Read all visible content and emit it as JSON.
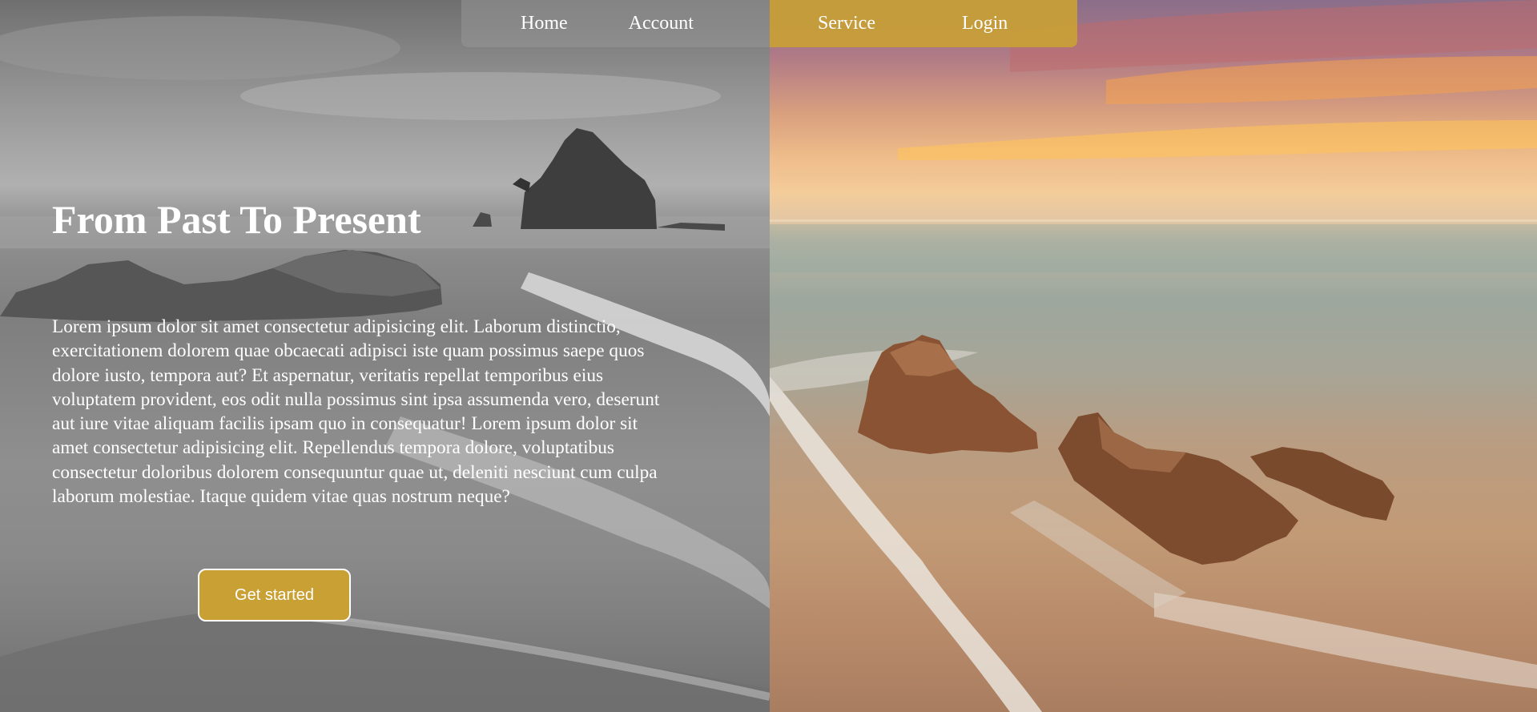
{
  "nav": {
    "items": [
      {
        "label": "Home"
      },
      {
        "label": "Account"
      },
      {
        "label": "Service"
      },
      {
        "label": "Login"
      }
    ]
  },
  "hero": {
    "title": "From Past To Present",
    "body": "Lorem ipsum dolor sit amet consectetur adipisicing elit. Laborum distinctio, exercitationem dolorem quae obcaecati adipisci iste quam possimus saepe quos dolore iusto, tempora aut? Et aspernatur, veritatis repellat temporibus eius voluptatem provident, eos odit nulla possimus sint ipsa assumenda vero, deserunt aut iure vitae aliquam facilis ipsam quo in consequatur! Lorem ipsum dolor sit amet consectetur adipisicing elit. Repellendus tempora dolore, voluptatibus consectetur doloribus dolorem consequuntur quae ut, deleniti nesciunt cum culpa laborum molestiae. Itaque quidem vitae quas nostrum neque?",
    "cta_label": "Get started"
  },
  "colors": {
    "accent": "#c9a033",
    "text": "#ffffff"
  }
}
